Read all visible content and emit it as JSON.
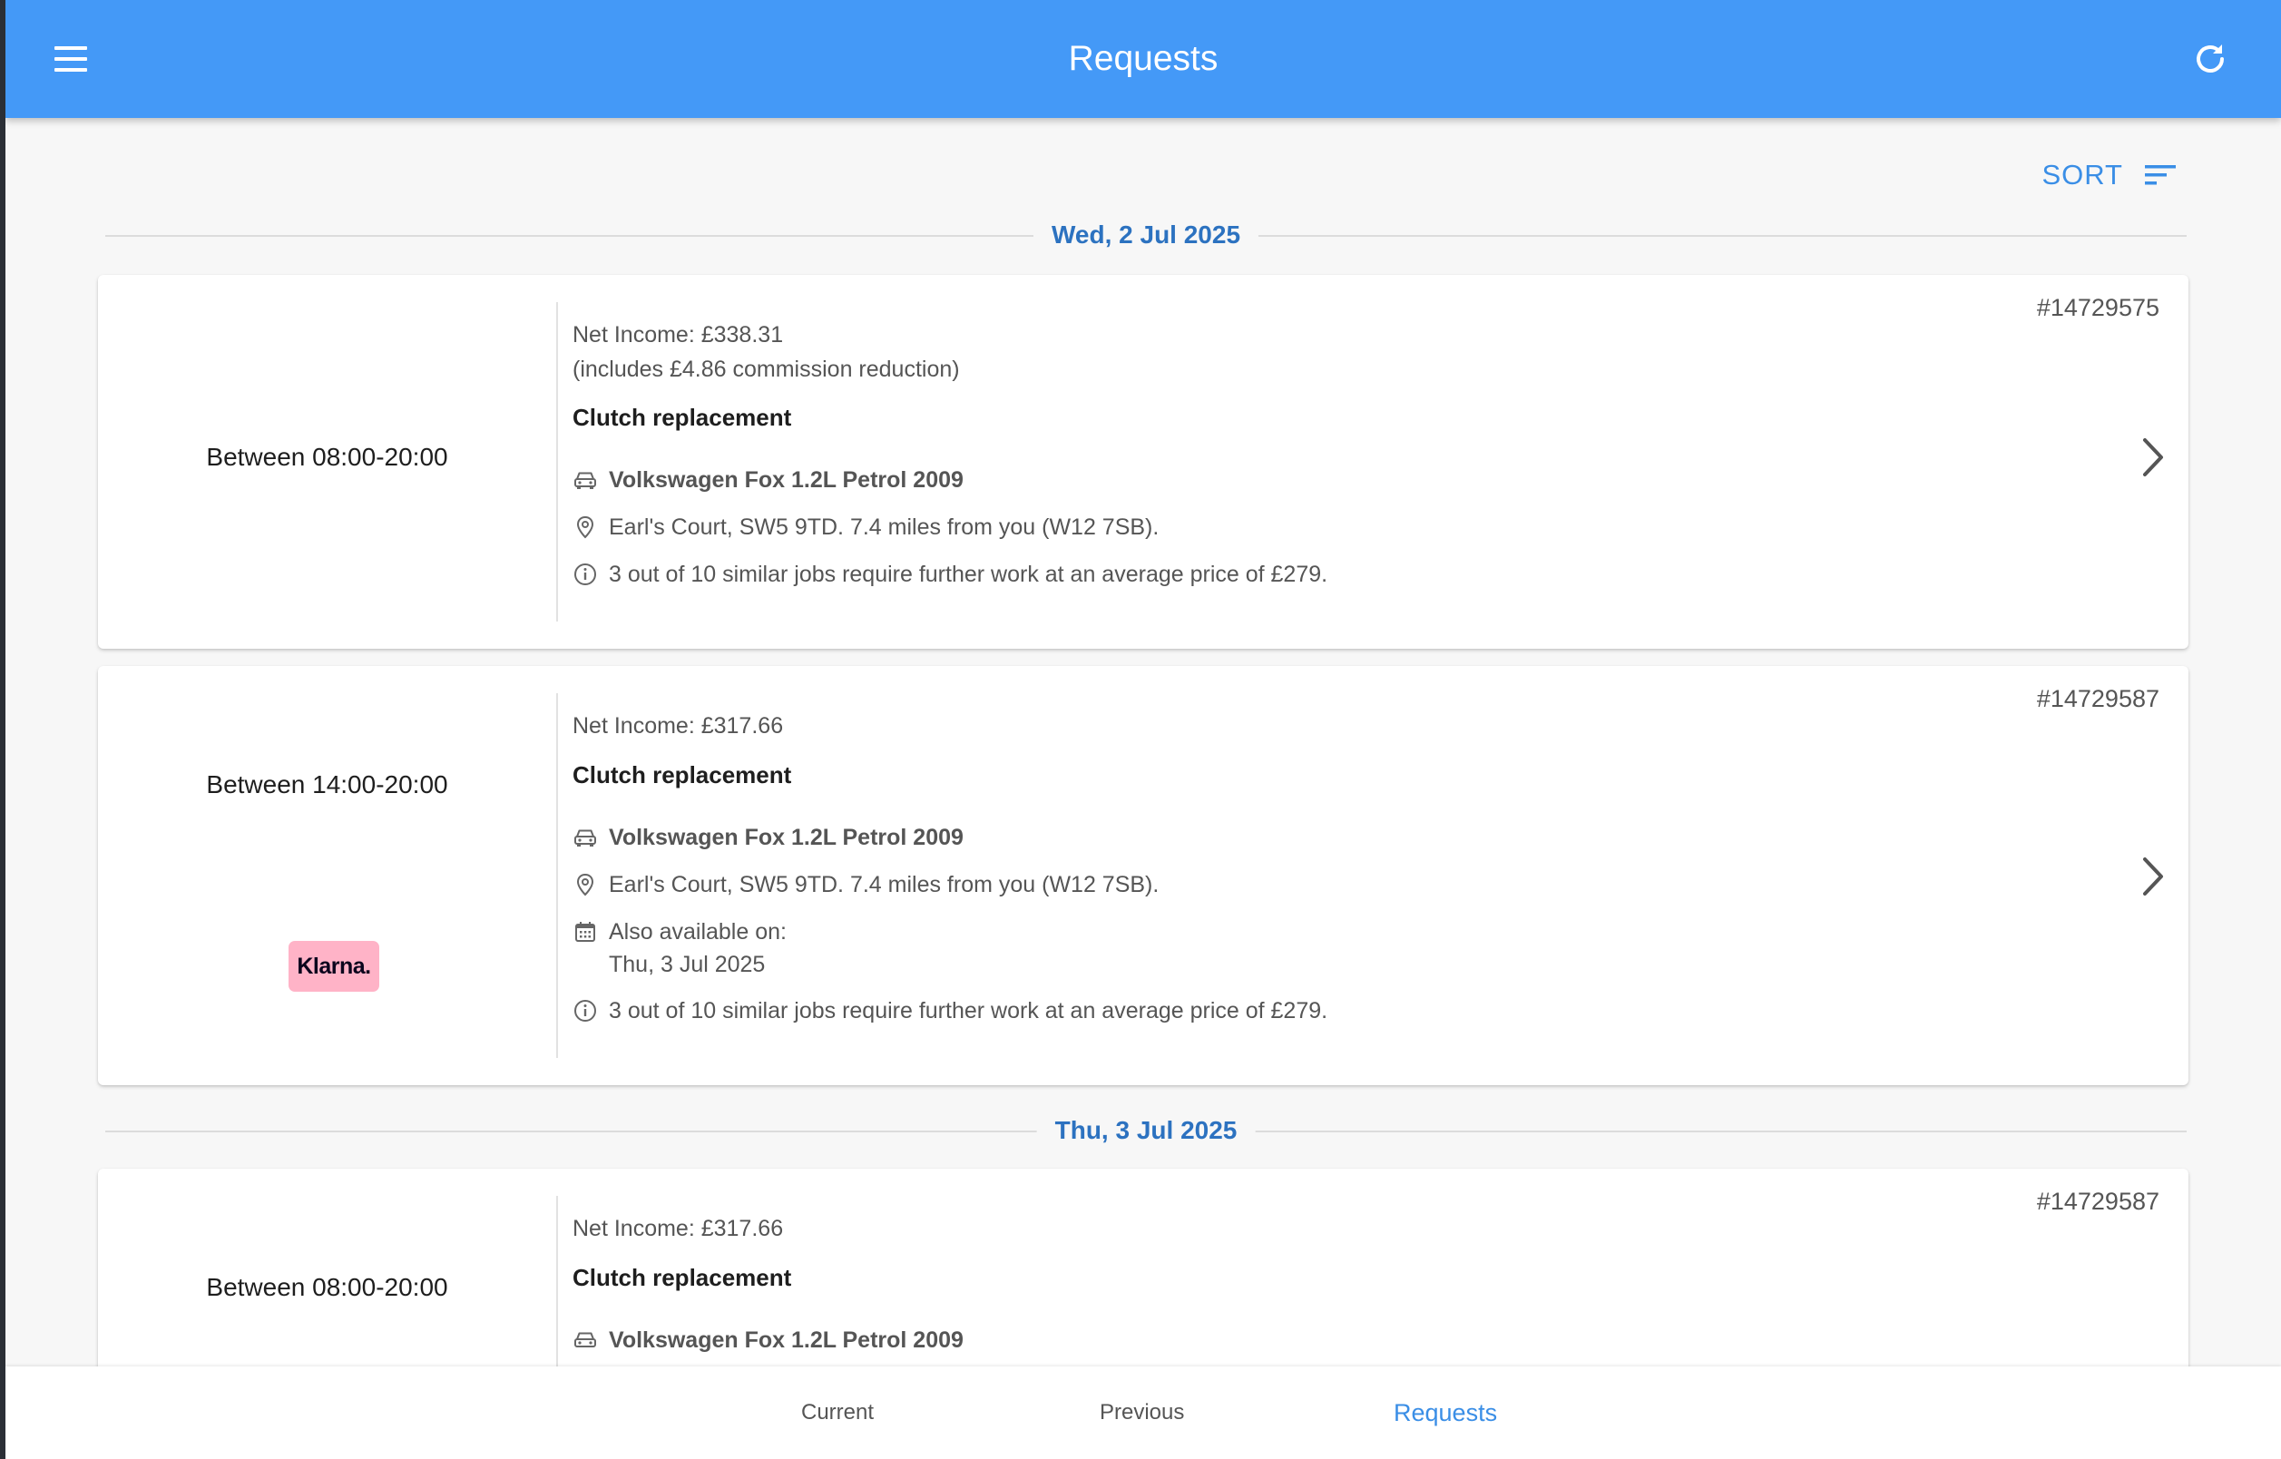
{
  "header": {
    "title": "Requests",
    "menu_icon": "hamburger-menu-icon",
    "refresh_icon": "refresh-icon",
    "bg_color": "#4499f7"
  },
  "sort": {
    "label": "SORT",
    "icon": "sort-lines-icon"
  },
  "date_groups": [
    {
      "label": "Wed, 2 Jul 2025"
    },
    {
      "label": "Thu, 3 Jul 2025"
    }
  ],
  "cards": [
    {
      "time": "Between 08:00-20:00",
      "job_id": "#14729575",
      "net_income": "Net Income: £338.31",
      "commission": "(includes £4.86 commission reduction)",
      "service": "Clutch replacement",
      "vehicle": "Volkswagen Fox 1.2L Petrol 2009",
      "location": "Earl's Court, SW5 9TD. 7.4 miles from you (W12 7SB).",
      "info": "3 out of 10 similar jobs require further work at an average price of £279."
    },
    {
      "time": "Between 14:00-20:00",
      "job_id": "#14729587",
      "net_income": "Net Income: £317.66",
      "service": "Clutch replacement",
      "vehicle": "Volkswagen Fox 1.2L Petrol 2009",
      "location": "Earl's Court, SW5 9TD. 7.4 miles from you (W12 7SB).",
      "also_label": "Also available on:",
      "also_date": "Thu, 3 Jul 2025",
      "info": "3 out of 10 similar jobs require further work at an average price of £279.",
      "payment_badge": "Klarna."
    },
    {
      "time": "Between 08:00-20:00",
      "job_id": "#14729587",
      "net_income": "Net Income: £317.66",
      "service": "Clutch replacement",
      "vehicle": "Volkswagen Fox 1.2L Petrol 2009"
    }
  ],
  "bottom_nav": {
    "items": [
      {
        "label": "Current"
      },
      {
        "label": "Previous"
      },
      {
        "label": "Requests"
      }
    ],
    "active": "Requests",
    "active_color": "#3a8ee6"
  }
}
